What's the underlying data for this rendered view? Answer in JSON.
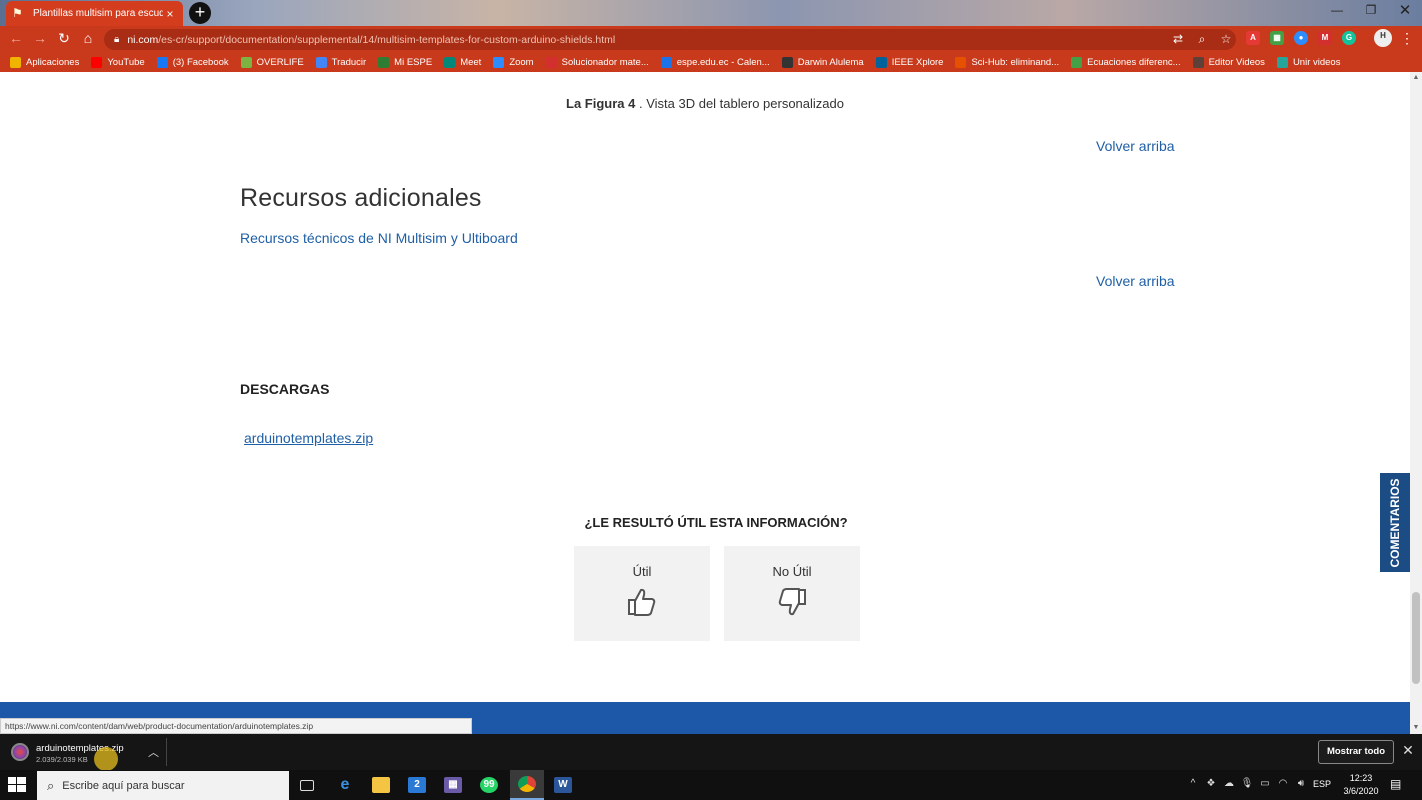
{
  "browser": {
    "tab_title": "Plantillas multisim para escudos",
    "tab_close": "×",
    "new_tab": "+",
    "url_host": "ni.com",
    "url_path": "/es-cr/support/documentation/supplemental/14/multisim-templates-for-custom-arduino-shields.html",
    "bookmarks": [
      {
        "label": "Aplicaciones",
        "icon": "apps-icon",
        "color": "#f0b400"
      },
      {
        "label": "YouTube",
        "icon": "youtube-icon",
        "color": "#ff0000"
      },
      {
        "label": "(3) Facebook",
        "icon": "facebook-icon",
        "color": "#1877f2"
      },
      {
        "label": "OVERLIFE",
        "icon": "overlife-icon",
        "color": "#7cb342"
      },
      {
        "label": "Traducir",
        "icon": "translate-icon",
        "color": "#4285f4"
      },
      {
        "label": "Mi ESPE",
        "icon": "espe-icon",
        "color": "#2e7d32"
      },
      {
        "label": "Meet",
        "icon": "meet-icon",
        "color": "#00897b"
      },
      {
        "label": "Zoom",
        "icon": "zoom-icon",
        "color": "#2d8cff"
      },
      {
        "label": "Solucionador mate...",
        "icon": "symbolab-icon",
        "color": "#d32f2f"
      },
      {
        "label": "espe.edu.ec - Calen...",
        "icon": "calendar-icon",
        "color": "#1a73e8"
      },
      {
        "label": "Darwin Alulema",
        "icon": "globe-icon",
        "color": "#333333"
      },
      {
        "label": "IEEE Xplore",
        "icon": "ieee-icon",
        "color": "#00629b"
      },
      {
        "label": "Sci-Hub: eliminand...",
        "icon": "scihub-icon",
        "color": "#e65100"
      },
      {
        "label": "Ecuaciones diferenc...",
        "icon": "shield-icon",
        "color": "#43a047"
      },
      {
        "label": "Editor Videos",
        "icon": "video-editor-icon",
        "color": "#5d4037"
      },
      {
        "label": "Unir videos",
        "icon": "play-icon",
        "color": "#26a69a"
      }
    ]
  },
  "page": {
    "figure_caption_bold": "La Figura 4",
    "figure_caption_rest": " . Vista 3D del tablero personalizado",
    "back_to_top": "Volver arriba",
    "section_title": "Recursos adicionales",
    "resource_link": "Recursos técnicos de NI Multisim y Ultiboard",
    "downloads_title": "DESCARGAS",
    "download_link": "arduinotemplates.zip",
    "feedback_question": "¿LE RESULTÓ ÚTIL ESTA INFORMACIÓN?",
    "feedback_useful": "Útil",
    "feedback_not_useful": "No Útil",
    "comments_tab": "COMENTARIOS",
    "status_url": "https://www.ni.com/content/dam/web/product-documentation/arduinotemplates.zip"
  },
  "download_bar": {
    "file_name": "arduinotemplates.zip",
    "file_size": "2.039/2.039 KB",
    "show_all": "Mostrar todo"
  },
  "taskbar": {
    "search_placeholder": "Escribe aquí para buscar",
    "language": "ESP",
    "time": "12:23",
    "date": "3/6/2020",
    "mail_badge": "2",
    "whatsapp_badge": "99"
  },
  "colors": {
    "chrome_red": "#c93a1c",
    "link_blue": "#1f5fa5",
    "footer_blue": "#1c57a8",
    "comments_blue": "#1c4c84"
  }
}
